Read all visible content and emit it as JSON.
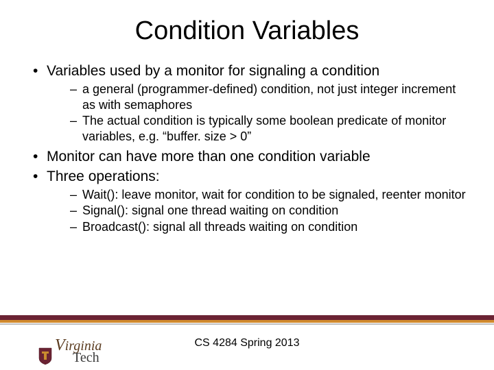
{
  "title": "Condition Variables",
  "bullets": [
    {
      "text": "Variables used by a monitor for signaling a condition",
      "sub": [
        "a general (programmer-defined) condition, not just integer increment as with semaphores",
        "The actual condition is typically some boolean predicate of monitor variables, e.g. “buffer. size > 0”"
      ]
    },
    {
      "text": "Monitor can have more than one condition variable",
      "sub": []
    },
    {
      "text": "Three operations:",
      "sub": [
        "Wait(): leave monitor, wait for condition to be signaled, reenter monitor",
        "Signal(): signal one thread waiting on condition",
        "Broadcast(): signal all threads waiting on condition"
      ]
    }
  ],
  "footer": "CS 4284 Spring 2013",
  "logo": {
    "line1a": "V",
    "line1b": "irginia",
    "line2": "Tech"
  }
}
